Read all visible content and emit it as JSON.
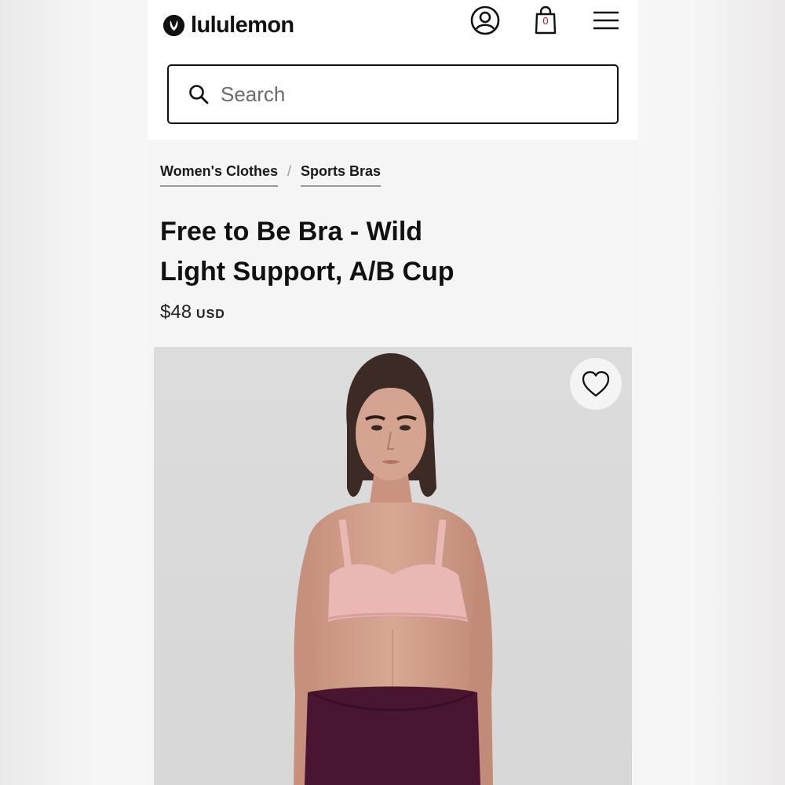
{
  "header": {
    "brand": "lululemon",
    "bag_count": "0",
    "icons": [
      "lululemon-logo-icon",
      "account-icon",
      "shopping-bag-icon",
      "menu-icon"
    ]
  },
  "search": {
    "placeholder": "Search",
    "value": "",
    "icon": "search-icon"
  },
  "breadcrumb": {
    "items": [
      "Women's Clothes",
      "Sports Bras"
    ],
    "separator": "/"
  },
  "product": {
    "title_line1": "Free to Be Bra - Wild",
    "title_line2": "Light Support, A/B Cup",
    "price": "$48",
    "currency": "USD"
  },
  "gallery": {
    "wishlist_icon": "heart-icon"
  },
  "colors": {
    "text": "#111111",
    "page_background": "#f5f5f5",
    "photo_background": "#d9d9d9",
    "bra": "#e9b7b4",
    "leggings": "#4a1530",
    "bag_count_color": "#c8102e"
  }
}
